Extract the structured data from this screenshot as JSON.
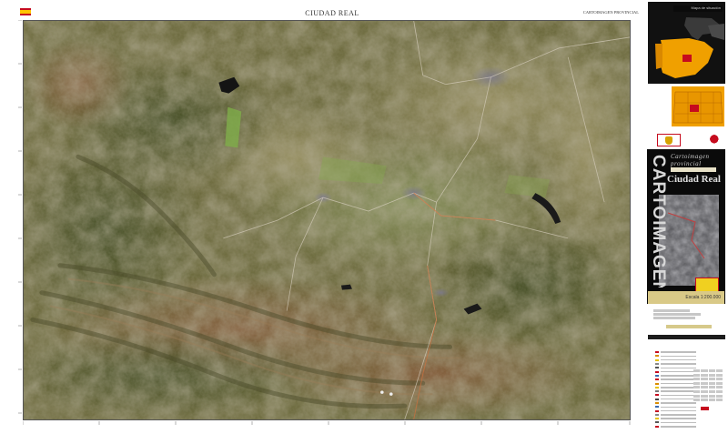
{
  "header": {
    "title": "CIUDAD REAL",
    "series": "CARTOIMAGEN PROVINCIAL"
  },
  "map": {
    "type": "satellite-orthoimage"
  },
  "side_panel": {
    "locator_heading": "Mapa de situación",
    "cover": {
      "series_line1": "Cartoimagen",
      "series_line2": "provincial",
      "city": "Ciudad Real",
      "vertical": "CARTOIMAGEN",
      "scale_label": "Escala 1:200.000"
    }
  },
  "colors": {
    "spain_flag_red": "#c60b1e",
    "spain_flag_yellow": "#ffc400",
    "cover_dark": "#0a0a0a",
    "locator_orange": "#f0a000"
  }
}
